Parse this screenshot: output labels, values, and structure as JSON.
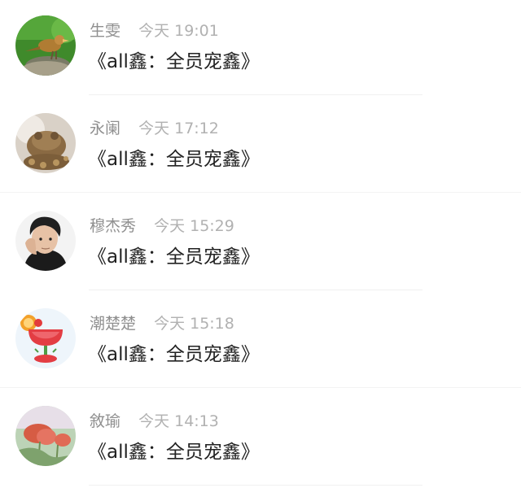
{
  "messages": [
    {
      "name": "生雯",
      "time": "今天 19:01",
      "text": "《all鑫：全员宠鑫》",
      "avatar_icon": "bird-avatar-icon"
    },
    {
      "name": "永阑",
      "time": "今天 17:12",
      "text": "《all鑫：全员宠鑫》",
      "avatar_icon": "toad-statue-avatar-icon"
    },
    {
      "name": "穆杰秀",
      "time": "今天 15:29",
      "text": "《all鑫：全员宠鑫》",
      "avatar_icon": "person-avatar-icon"
    },
    {
      "name": "潮楚楚",
      "time": "今天 15:18",
      "text": "《all鑫：全员宠鑫》",
      "avatar_icon": "cocktail-avatar-icon"
    },
    {
      "name": "敘瑜",
      "time": "今天 14:13",
      "text": "《all鑫：全员宠鑫》",
      "avatar_icon": "poppy-flower-avatar-icon"
    }
  ],
  "colors": {
    "name_text": "#8f8f8f",
    "time_text": "#b1b1b1",
    "message_text": "#222222",
    "divider": "#f0f0f0"
  }
}
